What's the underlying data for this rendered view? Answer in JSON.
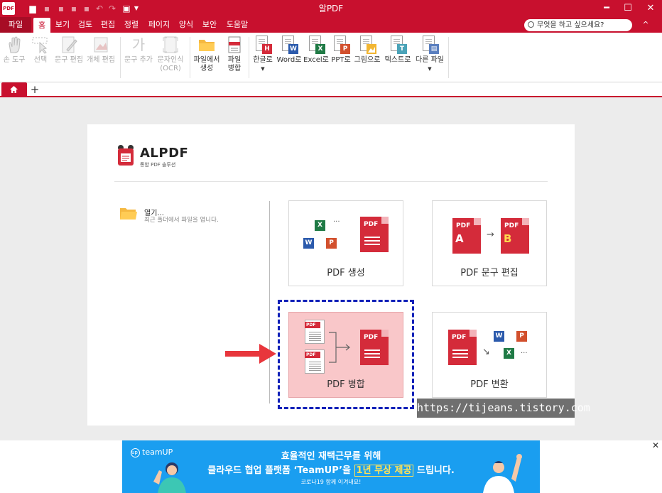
{
  "app": {
    "title": "알PDF",
    "logo_text": "PDF"
  },
  "window_controls": {
    "minimize": "━",
    "maximize": "☐",
    "close": "✕"
  },
  "menu": {
    "file": "파일",
    "items": [
      "홈",
      "보기",
      "검토",
      "편집",
      "정렬",
      "페이지",
      "양식",
      "보안",
      "도움말"
    ],
    "search_placeholder": "무엇을 하고 싶으세요?",
    "collapse": "^"
  },
  "ribbon": {
    "hand": "손 도구",
    "select": "선택",
    "text_edit": "문구 편집",
    "object_edit": "개체 편집",
    "add_text": "문구 추가",
    "ocr_line1": "문자인식",
    "ocr_line2": "(OCR)",
    "from_file_line1": "파일에서",
    "from_file_line2": "생성",
    "merge_line1": "파일",
    "merge_line2": "병합",
    "to_hwp": "한글로",
    "to_word": "Word로",
    "to_excel": "Excel로",
    "to_ppt": "PPT로",
    "to_image": "그림으로",
    "to_text": "텍스트로",
    "to_other": "다른 파일"
  },
  "badges": {
    "hwp": "H",
    "word": "W",
    "excel": "X",
    "ppt": "P",
    "text": "T",
    "pdf": "PDF"
  },
  "tabs": {
    "new_tab": "+"
  },
  "start": {
    "brand_name": "ALPDF",
    "brand_sub": "통합 PDF 솔루션",
    "open_title": "열기...",
    "open_desc": "최근 폴더에서 파일을 엽니다.",
    "cards": {
      "create": "PDF 생성",
      "text_edit": "PDF 문구 편집",
      "merge": "PDF 병합",
      "convert": "PDF 변환"
    },
    "letter_a": "A",
    "letter_b": "B",
    "ellipsis": "···",
    "arrow": "→",
    "arrow_down": "↘"
  },
  "watermark": "https://tijeans.tistory.com",
  "ad": {
    "brand": "teamUP",
    "brand_mark": "up",
    "line1": "효율적인 재택근무를 위해",
    "line2_pre": "클라우드 협업 플랫폼 ‘TeamUP’을 ",
    "line2_hi1": "1년 무상 제공",
    "line2_post": " 드립니다.",
    "line3": "코로나19 함께 이겨내요!",
    "close": "✕"
  },
  "colors": {
    "brand_red": "#c8102e",
    "pdf_red": "#d42b3a",
    "word": "#2b5aac",
    "excel": "#1f7a45",
    "ppt": "#d2502d",
    "focus": "#1020b8",
    "ad_blue": "#1a9ef0"
  }
}
